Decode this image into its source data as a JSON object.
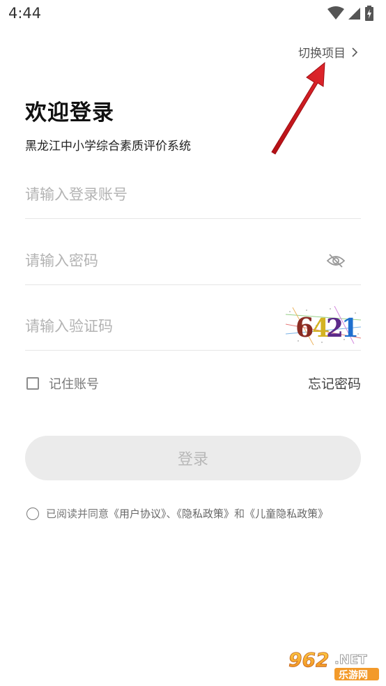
{
  "status_bar": {
    "time": "4:44",
    "icons": [
      "wifi-icon",
      "signal-icon",
      "battery-charging-icon"
    ]
  },
  "header": {
    "switch_project_label": "切换项目",
    "switch_icon": "chevron-right-icon"
  },
  "welcome": {
    "title": "欢迎登录",
    "subtitle": "黑龙江中小学综合素质评价系统",
    "highlight_color": "#fcd64a"
  },
  "form": {
    "account_placeholder": "请输入登录账号",
    "password_placeholder": "请输入密码",
    "password_toggle_icon": "eye-off-icon",
    "captcha_placeholder": "请输入验证码",
    "captcha_code": "6421",
    "remember_label": "记住账号",
    "forgot_label": "忘记密码",
    "login_label": "登录"
  },
  "agreement": {
    "prefix": "已阅读并同意",
    "user_agreement": "《用户协议》",
    "separator": "、",
    "privacy_policy": "《隐私政策》",
    "conjunction": "和",
    "child_privacy_policy": "《儿童隐私政策》"
  },
  "watermark": {
    "brand": "962",
    "suffix": ".NET",
    "sub": "乐游网"
  },
  "colors": {
    "accent_yellow": "#fcd64a",
    "arrow_red": "#d9171e",
    "button_bg": "#ebebeb",
    "placeholder": "#b3b3b3"
  }
}
